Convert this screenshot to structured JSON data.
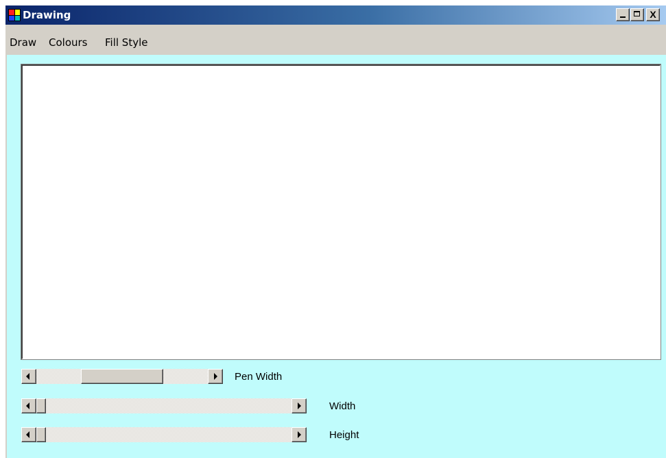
{
  "window": {
    "title": "Drawing",
    "controls": {
      "minimize": "_",
      "maximize": "□",
      "close": "X"
    }
  },
  "menu": {
    "items": [
      {
        "label": "Draw"
      },
      {
        "label": "Colours"
      },
      {
        "label": "Fill Style"
      }
    ]
  },
  "icons": {
    "app": "drawing-app-icon",
    "scroll_left": "triangle-left-icon",
    "scroll_right": "triangle-right-icon"
  },
  "colors": {
    "client_background": "#c0fcfc",
    "canvas_background": "#ffffff",
    "titlebar_start": "#0a246a",
    "titlebar_end": "#a6caf0"
  },
  "sliders": [
    {
      "label": "Pen Width",
      "value_fraction": 0.5
    },
    {
      "label": "Width",
      "value_fraction": 0.0
    },
    {
      "label": "Height",
      "value_fraction": 0.0
    }
  ]
}
